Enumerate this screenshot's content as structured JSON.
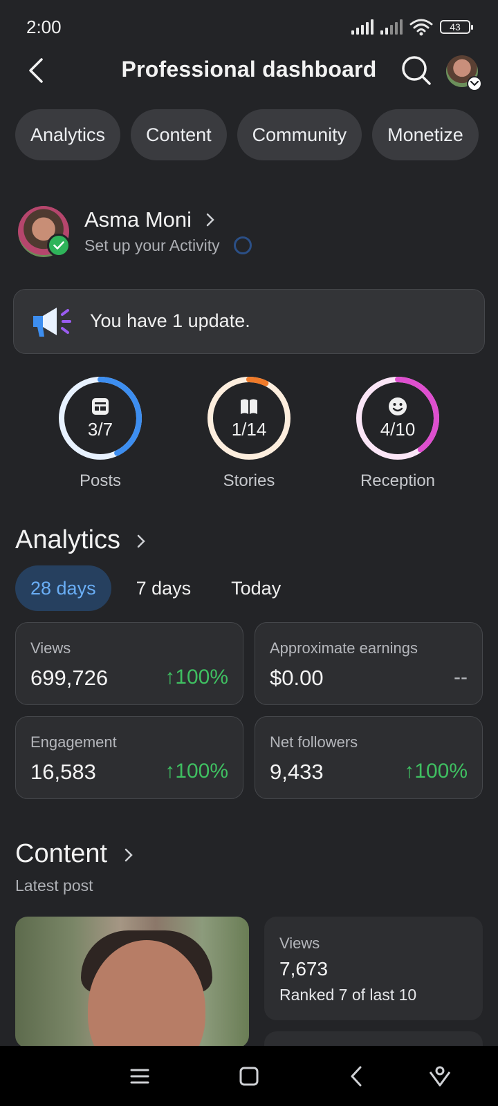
{
  "status_bar": {
    "time": "2:00",
    "battery": "43"
  },
  "header": {
    "title": "Professional dashboard"
  },
  "tabs": [
    {
      "label": "Analytics"
    },
    {
      "label": "Content"
    },
    {
      "label": "Community"
    },
    {
      "label": "Monetize"
    }
  ],
  "profile": {
    "name": "Asma Moni",
    "subtitle": "Set up your Activity"
  },
  "update": {
    "text": "You have 1 update."
  },
  "progress_rings": [
    {
      "label": "Posts",
      "value": "3/7",
      "fraction": 0.4286,
      "color": "#3d8ef0",
      "track": "#e8f2ff",
      "icon": "post-icon"
    },
    {
      "label": "Stories",
      "value": "1/14",
      "fraction": 0.0714,
      "color": "#f07b2a",
      "track": "#fdeede",
      "icon": "book-icon"
    },
    {
      "label": "Reception",
      "value": "4/10",
      "fraction": 0.4,
      "color": "#de4fcf",
      "track": "#fbe6f7",
      "icon": "smiley-icon"
    }
  ],
  "analytics": {
    "title": "Analytics",
    "ranges": [
      {
        "label": "28 days",
        "active": true
      },
      {
        "label": "7 days",
        "active": false
      },
      {
        "label": "Today",
        "active": false
      }
    ],
    "stats": [
      {
        "label": "Views",
        "value": "699,726",
        "change": "↑100%"
      },
      {
        "label": "Approximate earnings",
        "value": "$0.00",
        "change": "--"
      },
      {
        "label": "Engagement",
        "value": "16,583",
        "change": "↑100%"
      },
      {
        "label": "Net followers",
        "value": "9,433",
        "change": "↑100%"
      }
    ]
  },
  "content": {
    "title": "Content",
    "subtitle": "Latest post",
    "post_views_label": "Views",
    "post_views_value": "7,673",
    "post_rank": "Ranked 7 of last 10"
  },
  "colors": {
    "background": "#232427",
    "accent_blue": "#6aaef5",
    "positive": "#3fbf61"
  }
}
